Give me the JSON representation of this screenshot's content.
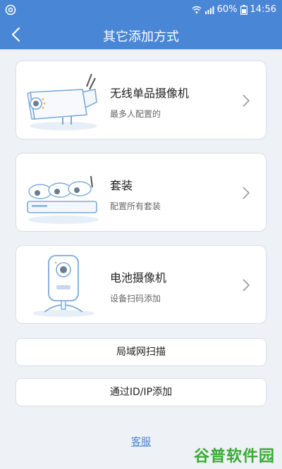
{
  "status_bar": {
    "battery": "60%",
    "time": "14:56"
  },
  "header": {
    "title": "其它添加方式"
  },
  "cards": [
    {
      "name": "无线单品摄像机",
      "desc": "最多人配置的"
    },
    {
      "name": "套装",
      "desc": "配置所有套装"
    },
    {
      "name": "电池摄像机",
      "desc": "设备扫码添加"
    }
  ],
  "buttons": {
    "lan_scan": "局域网扫描",
    "add_by_id": "通过ID/IP添加"
  },
  "footer": {
    "support": "客服"
  },
  "watermark": "谷普软件园",
  "colors": {
    "accent": "#4a86d6",
    "watermark": "#3aaa35"
  }
}
